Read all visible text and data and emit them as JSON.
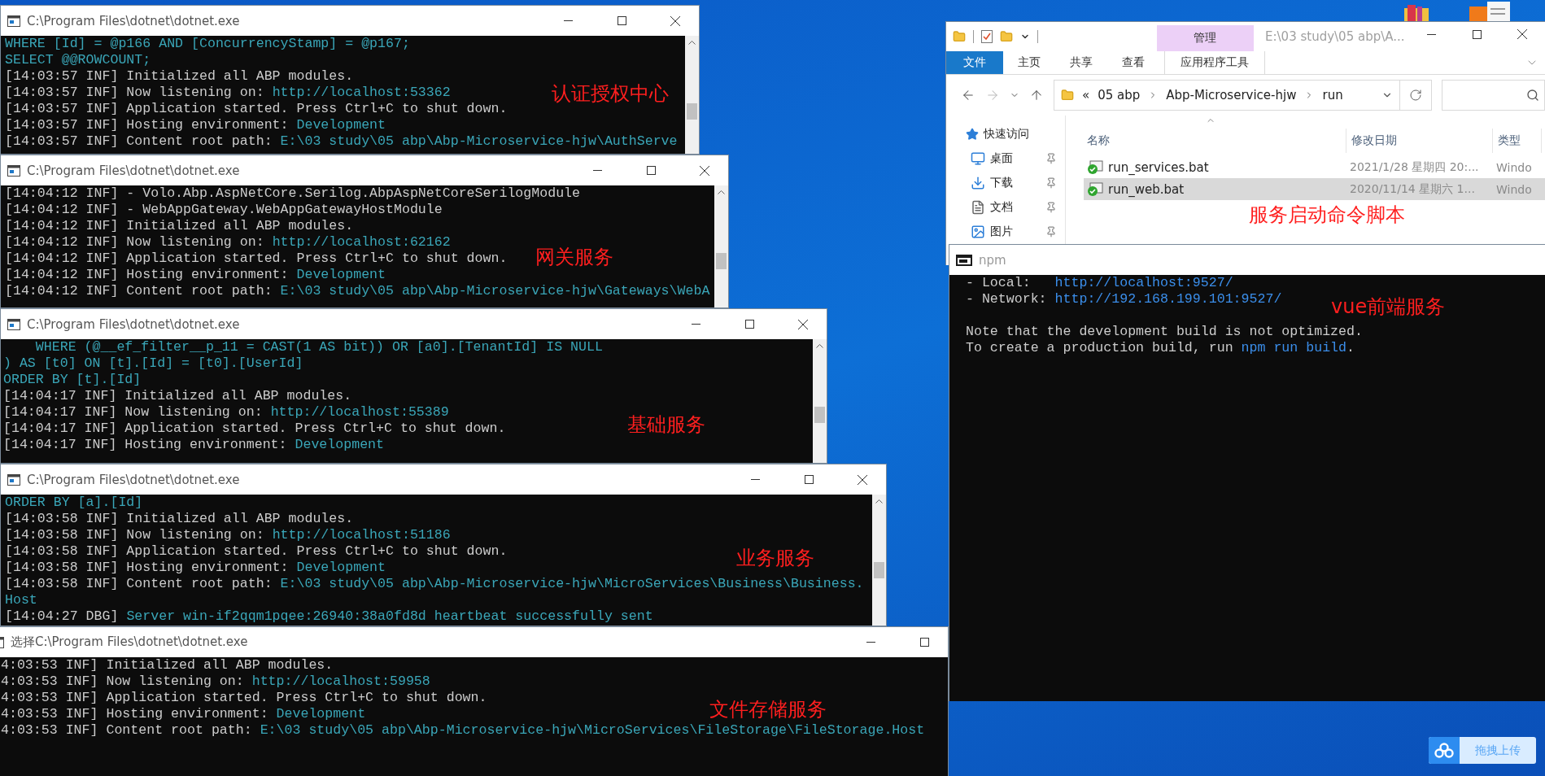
{
  "consoles": [
    {
      "title": "C:\\Program Files\\dotnet\\dotnet.exe",
      "annotation": "认证授权中心",
      "lines": [
        [
          {
            "text": "WHERE [Id] = @p166 AND [ConcurrencyStamp] = @p167;",
            "hl": true
          }
        ],
        [
          {
            "text": "SELECT @@ROWCOUNT;",
            "hl": true
          }
        ],
        [
          {
            "text": "[14:03:57 INF] Initialized all ABP modules.",
            "hl": false
          }
        ],
        [
          {
            "text": "[14:03:57 INF] Now listening on: ",
            "hl": false
          },
          {
            "text": "http://localhost:53362",
            "hl": true
          }
        ],
        [
          {
            "text": "[14:03:57 INF] Application started. Press Ctrl+C to shut down.",
            "hl": false
          }
        ],
        [
          {
            "text": "[14:03:57 INF] Hosting environment: ",
            "hl": false
          },
          {
            "text": "Development",
            "hl": true
          }
        ],
        [
          {
            "text": "[14:03:57 INF] Content root path: ",
            "hl": false
          },
          {
            "text": "E:\\03 study\\05 abp\\Abp-Microservice-hjw\\AuthServe",
            "hl": true
          }
        ]
      ]
    },
    {
      "title": "C:\\Program Files\\dotnet\\dotnet.exe",
      "annotation": "网关服务",
      "lines": [
        [
          {
            "text": "[14:04:12 INF] - Volo.Abp.AspNetCore.Serilog.AbpAspNetCoreSerilogModule",
            "hl": false
          }
        ],
        [
          {
            "text": "[14:04:12 INF] - WebAppGateway.WebAppGatewayHostModule",
            "hl": false
          }
        ],
        [
          {
            "text": "[14:04:12 INF] Initialized all ABP modules.",
            "hl": false
          }
        ],
        [
          {
            "text": "[14:04:12 INF] Now listening on: ",
            "hl": false
          },
          {
            "text": "http://localhost:62162",
            "hl": true
          }
        ],
        [
          {
            "text": "[14:04:12 INF] Application started. Press Ctrl+C to shut down.",
            "hl": false
          }
        ],
        [
          {
            "text": "[14:04:12 INF] Hosting environment: ",
            "hl": false
          },
          {
            "text": "Development",
            "hl": true
          }
        ],
        [
          {
            "text": "[14:04:12 INF] Content root path: ",
            "hl": false
          },
          {
            "text": "E:\\03 study\\05 abp\\Abp-Microservice-hjw\\Gateways\\WebA",
            "hl": true
          }
        ]
      ]
    },
    {
      "title": "C:\\Program Files\\dotnet\\dotnet.exe",
      "annotation": "基础服务",
      "lines": [
        [
          {
            "text": "    WHERE (@__ef_filter__p_11 = CAST(1 AS bit)) OR [a0].[TenantId] IS NULL",
            "hl": true
          }
        ],
        [
          {
            "text": ") AS [t0] ON [t].[Id] = [t0].[UserId]",
            "hl": true
          }
        ],
        [
          {
            "text": "ORDER BY [t].[Id]",
            "hl": true
          }
        ],
        [
          {
            "text": "[14:04:17 INF] Initialized all ABP modules.",
            "hl": false
          }
        ],
        [
          {
            "text": "[14:04:17 INF] Now listening on: ",
            "hl": false
          },
          {
            "text": "http://localhost:55389",
            "hl": true
          }
        ],
        [
          {
            "text": "[14:04:17 INF] Application started. Press Ctrl+C to shut down.",
            "hl": false
          }
        ],
        [
          {
            "text": "[14:04:17 INF] Hosting environment: ",
            "hl": false
          },
          {
            "text": "Development",
            "hl": true
          }
        ]
      ]
    },
    {
      "title": "C:\\Program Files\\dotnet\\dotnet.exe",
      "annotation": "业务服务",
      "lines": [
        [
          {
            "text": "ORDER BY [a].[Id]",
            "hl": true
          }
        ],
        [
          {
            "text": "[14:03:58 INF] Initialized all ABP modules.",
            "hl": false
          }
        ],
        [
          {
            "text": "[14:03:58 INF] Now listening on: ",
            "hl": false
          },
          {
            "text": "http://localhost:51186",
            "hl": true
          }
        ],
        [
          {
            "text": "[14:03:58 INF] Application started. Press Ctrl+C to shut down.",
            "hl": false
          }
        ],
        [
          {
            "text": "[14:03:58 INF] Hosting environment: ",
            "hl": false
          },
          {
            "text": "Development",
            "hl": true
          }
        ],
        [
          {
            "text": "[14:03:58 INF] Content root path: ",
            "hl": false
          },
          {
            "text": "E:\\03 study\\05 abp\\Abp-Microservice-hjw\\MicroServices\\Business\\Business.",
            "hl": true
          }
        ],
        [
          {
            "text": "Host",
            "hl": true
          }
        ],
        [
          {
            "text": "[14:04:27 DBG] ",
            "hl": false
          },
          {
            "text": "Server win-if2qqm1pqee:26940:38a0fd8d heartbeat successfully sent",
            "hl": true
          }
        ]
      ]
    },
    {
      "title": "选择C:\\Program Files\\dotnet\\dotnet.exe",
      "annotation": "文件存储服务",
      "lines": [
        [
          {
            "text": "4:03:53 INF] Initialized all ABP modules.",
            "hl": false
          }
        ],
        [
          {
            "text": "4:03:53 INF] Now listening on: ",
            "hl": false
          },
          {
            "text": "http://localhost:59958",
            "hl": true
          }
        ],
        [
          {
            "text": "4:03:53 INF] Application started. Press Ctrl+C to shut down.",
            "hl": false
          }
        ],
        [
          {
            "text": "4:03:53 INF] Hosting environment: ",
            "hl": false
          },
          {
            "text": "Development",
            "hl": true
          }
        ],
        [
          {
            "text": "4:03:53 INF] Content root path: ",
            "hl": false
          },
          {
            "text": "E:\\03 study\\05 abp\\Abp-Microservice-hjw\\MicroServices\\FileStorage\\FileStorage.Host",
            "hl": true
          }
        ]
      ]
    }
  ],
  "explorer": {
    "title": "E:\\03 study\\05 abp\\A...",
    "context_tab": "管理",
    "ribbon_tabs": [
      {
        "label": "文件",
        "kind": "file"
      },
      {
        "label": "主页",
        "kind": "plain"
      },
      {
        "label": "共享",
        "kind": "plain"
      },
      {
        "label": "查看",
        "kind": "plain"
      },
      {
        "label": "应用程序工具",
        "kind": "context"
      }
    ],
    "overflow_mark": "«",
    "breadcrumb": [
      "05 abp",
      "Abp-Microservice-hjw",
      "run"
    ],
    "nav": [
      {
        "label": "快速访问",
        "kind": "star",
        "pinned": false
      },
      {
        "label": "桌面",
        "kind": "desktop",
        "pinned": true
      },
      {
        "label": "下载",
        "kind": "download",
        "pinned": true
      },
      {
        "label": "文档",
        "kind": "document",
        "pinned": true
      },
      {
        "label": "图片",
        "kind": "pictures",
        "pinned": true
      }
    ],
    "columns": [
      "名称",
      "修改日期",
      "类型"
    ],
    "files": [
      {
        "name": "run_services.bat",
        "date": "2021/1/28 星期四 20:...",
        "type": "Windo",
        "selected": false
      },
      {
        "name": "run_web.bat",
        "date": "2020/11/14 星期六 1...",
        "type": "Windo",
        "selected": true
      }
    ],
    "annotation": "服务启动命令脚本"
  },
  "npm": {
    "title": "npm",
    "annotation": "vue前端服务",
    "blocks": [
      [
        [
          {
            "text": "- Local:   ",
            "hl": false
          },
          {
            "text": "http://localhost:9527/",
            "hl": true
          }
        ],
        [
          {
            "text": "- Network: ",
            "hl": false
          },
          {
            "text": "http://192.168.199.101:9527/",
            "hl": true
          }
        ]
      ],
      [
        [
          {
            "text": "Note that the development build is not optimized.",
            "hl": false
          }
        ],
        [
          {
            "text": "To create a production build, run ",
            "hl": false
          },
          {
            "text": "npm run build",
            "hl": true
          },
          {
            "text": ".",
            "hl": false
          }
        ]
      ]
    ]
  },
  "upload_button": {
    "label": "拖拽上传"
  }
}
